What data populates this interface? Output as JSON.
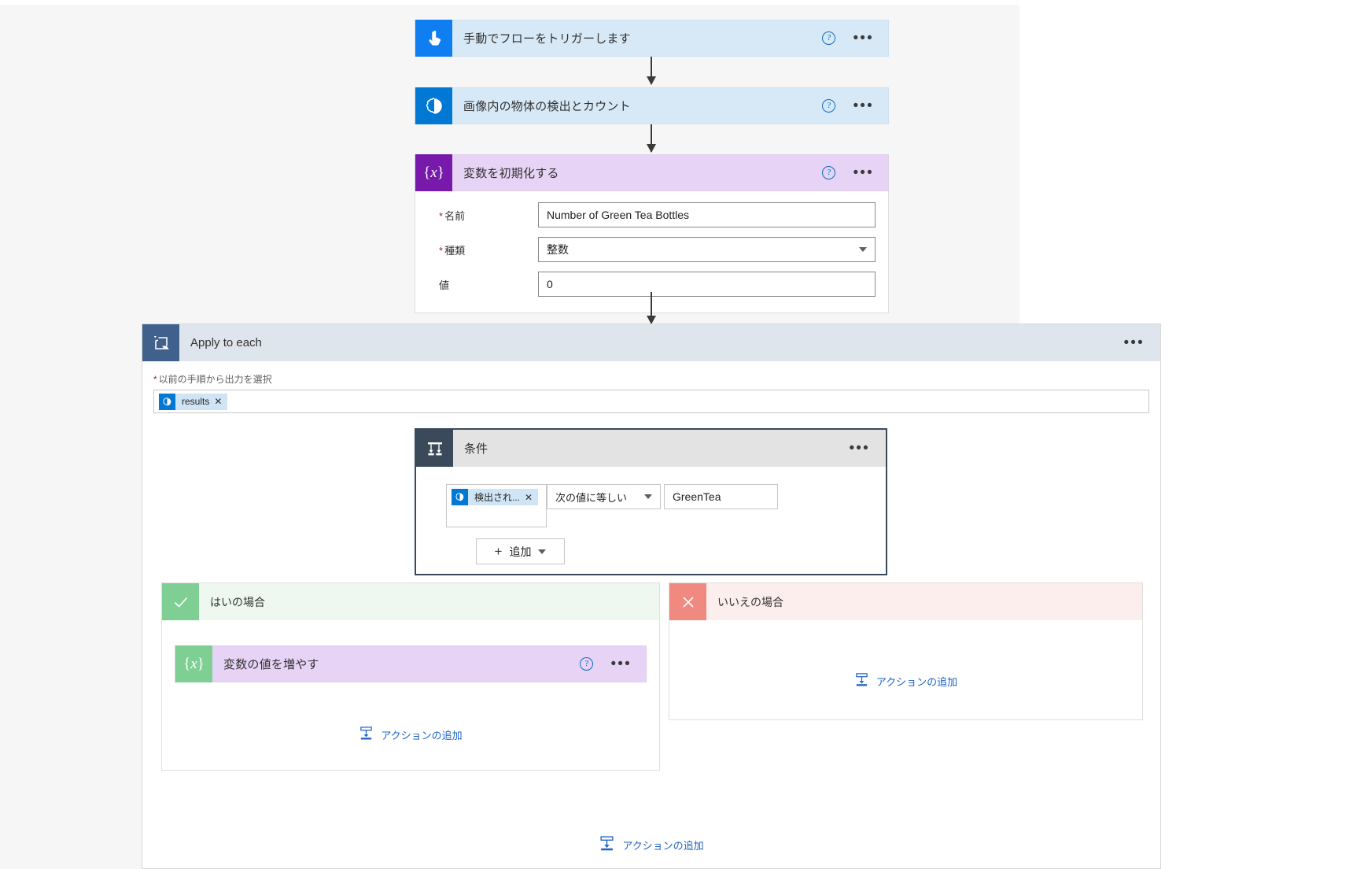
{
  "flow": {
    "trigger": {
      "title": "手動でフローをトリガーします",
      "icon": "manual-trigger-icon",
      "help_label": "?",
      "menu_label": "•••"
    },
    "detect_action": {
      "title": "画像内の物体の検出とカウント",
      "icon": "ai-builder-icon",
      "help_label": "?",
      "menu_label": "•••"
    },
    "init_variable": {
      "title": "変数を初期化する",
      "icon": "variable-icon",
      "help_label": "?",
      "menu_label": "•••",
      "fields": [
        {
          "label": "名前",
          "required": true,
          "value": "Number of Green Tea Bottles",
          "type": "text"
        },
        {
          "label": "種類",
          "required": true,
          "value": "整数",
          "type": "select"
        },
        {
          "label": "値",
          "required": false,
          "value": "0",
          "type": "text"
        }
      ]
    },
    "apply_to_each": {
      "title": "Apply to each",
      "icon": "loop-icon",
      "menu_label": "•••",
      "field_label": "以前の手順から出力を選択",
      "field_required": true,
      "token": {
        "label": "results",
        "icon": "ai-builder-icon",
        "remove_label": "✕"
      }
    },
    "condition": {
      "title": "条件",
      "icon": "condition-icon",
      "menu_label": "•••",
      "operand_token": {
        "label": "検出され...",
        "icon": "ai-builder-icon",
        "remove_label": "✕"
      },
      "operator": "次の値に等しい",
      "value": "GreenTea",
      "add_button": "追加",
      "add_button_plus": "+"
    },
    "yes_branch": {
      "title": "はいの場合",
      "icon": "checkmark-icon",
      "action": {
        "title": "変数の値を増やす",
        "icon": "variable-icon",
        "help_label": "?",
        "menu_label": "•••"
      },
      "add_action_label": "アクションの追加",
      "add_action_icon": "add-action-icon"
    },
    "no_branch": {
      "title": "いいえの場合",
      "icon": "cross-icon",
      "add_action_label": "アクションの追加",
      "add_action_icon": "add-action-icon"
    },
    "loop_add_action": {
      "label": "アクションの追加",
      "icon": "add-action-icon"
    }
  },
  "colors": {
    "trigger_blue": "#0f7ef0",
    "action_blue": "#0078d4",
    "variable_purple": "#7719aa",
    "loop_slate": "#41618d",
    "condition_slate": "#3b4a5a",
    "yes_green": "#7fcf94",
    "no_red": "#f08a81",
    "link_blue": "#1f63c4"
  }
}
